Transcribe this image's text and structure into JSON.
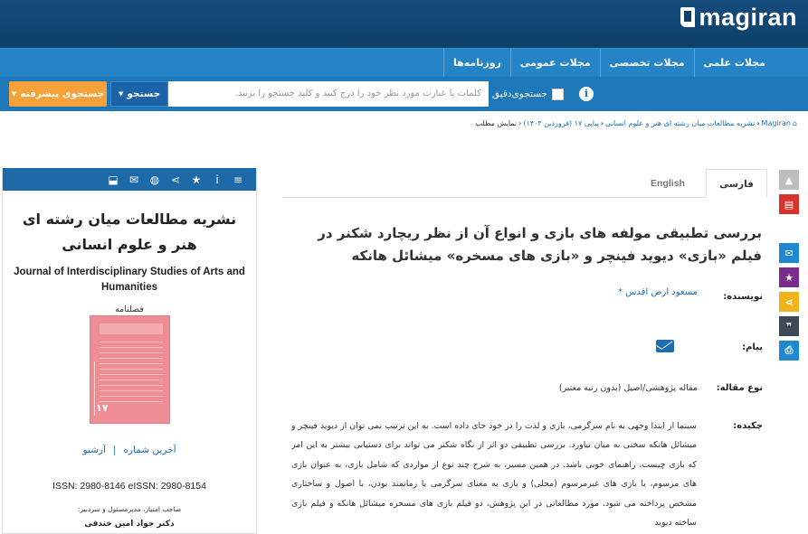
{
  "brand": {
    "name": "magiran"
  },
  "nav": {
    "items": [
      "مجلات علمی",
      "مجلات تخصصی",
      "مجلات عمومی",
      "روزنامه‌ها"
    ]
  },
  "search": {
    "advanced_label": "جستجوی پیشرفته",
    "button_label": "جستجو",
    "placeholder": "کلمات یا عبارت مورد نظر خود را درج کنید و کلید جستجو را بزنید.",
    "exact_label": "جستجوی‌دقیق",
    "exact_checked": false
  },
  "breadcrumb": [
    "Magiran",
    "نشریه مطالعات میان رشته ای هنر و علوم انسانی",
    "پیاپی ۱۷ (فروردین ۱۴۰۳)",
    "نمایش مطلب"
  ],
  "journal": {
    "title": "نشریه مطالعات میان رشته ای هنر و علوم انسانی",
    "title_en": "Journal of Interdisciplinary Studies of Arts and Humanities",
    "frequency": "فصلنامه",
    "cover_number": "۱۷",
    "latest_issue": "آخرین شماره",
    "archive": "آرشیو",
    "issn": "ISSN: 2980-8146 eISSN: 2980-8154",
    "owner_label": "صاحب امتیاز، مدیرمسئول و سردبیر:",
    "editor": "دکتر جواد امین خندقی"
  },
  "tabs": {
    "farsi": "فارسی",
    "english": "English"
  },
  "article": {
    "title": "بررسی تطبیقی مولفه های بازی و انواع آن از نظر ریچارد شکنر در فیلم «بازی» دیوید فینچر و «بازی های مسخره» میشائل هانکه",
    "author_label": "نویسنده:",
    "author": "مسعود ارض اقدس *",
    "message_label": "پیام:",
    "type_label": "نوع مقاله:",
    "type": "مقاله پژوهشی/اصیل (بدون رتبه معتبر)",
    "abstract_label": "چکیده:",
    "abstract": "سینما از ابتدا وجهی به نام سرگرمی، بازی و لذت را در خود جای داده است. به این ترتیب نمی توان از دیوید فینچر و میشائل هانکه سخنی به میان نیاورد. بررسی تطبیقی دو اثر از نگاه شکنر می تواند برای دستیابی بیشتر به این امر که بازی چیست، راهنمای خوبی باشد. در همین مسیر، به شرح چند نوع از مواردی که شامل بازی، به عنوان بازی های مرسوم، یا بازی های غیرمرسوم (محلی) و بازی به معنای سرگرمی یا زمانمند بودن، با اصول و ساختاری مشخص پرداخته می شود. مورد مطالعاتی در این پژوهش، دو فیلم بازی های مسخره میشائل هانکه و فیلم بازی ساخته دیوید"
  },
  "colors": {
    "topbar": "#0e3f69",
    "nav": "#2584c5",
    "search": "#1d78b9",
    "advanced": "#f7a13a",
    "link": "#1d6fb2"
  }
}
